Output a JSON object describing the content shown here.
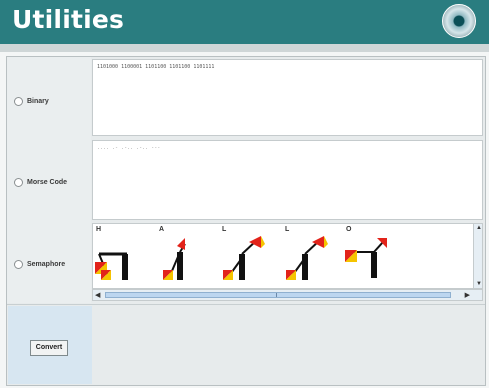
{
  "header": {
    "title": "Utilities"
  },
  "options": {
    "binary_label": "Binary",
    "morse_label": "Morse Code",
    "semaphore_label": "Semaphore"
  },
  "binary": {
    "value": "1101000 1100001 1101100 1101100 1101111"
  },
  "morse": {
    "value": ".... .- .-.. .-.. ---"
  },
  "semaphore": {
    "letters": [
      "H",
      "A",
      "L",
      "L",
      "O"
    ]
  },
  "actions": {
    "convert_label": "Convert"
  },
  "colors": {
    "header_bg": "#2a7d80",
    "flag_red": "#e2231a",
    "flag_yellow": "#f5c400"
  },
  "icons": {
    "header_icon": "disc-icon",
    "scroll_up": "arrow-up-icon",
    "scroll_down": "arrow-down-icon",
    "scroll_left": "arrow-left-icon",
    "scroll_right": "arrow-right-icon"
  }
}
